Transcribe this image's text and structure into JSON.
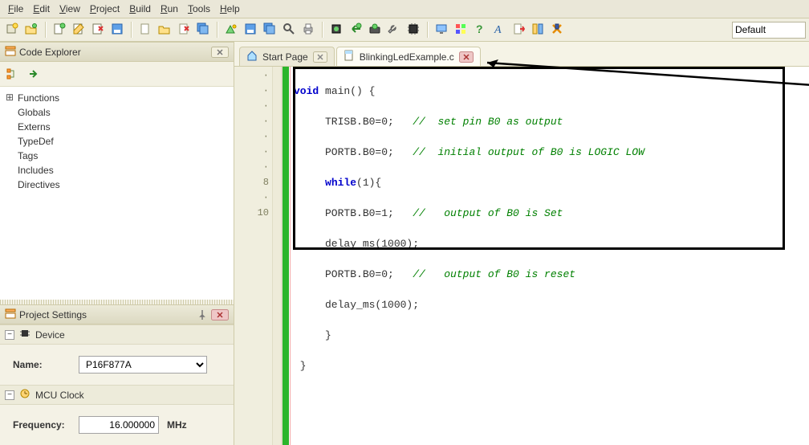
{
  "menu": {
    "items": [
      "File",
      "Edit",
      "View",
      "Project",
      "Build",
      "Run",
      "Tools",
      "Help"
    ]
  },
  "toolbar": {
    "default": "Default"
  },
  "explorer": {
    "title": "Code Explorer",
    "items": [
      "Functions",
      "Globals",
      "Externs",
      "TypeDef",
      "Tags",
      "Includes",
      "Directives"
    ]
  },
  "project": {
    "title": "Project Settings",
    "device_section": "Device",
    "name_label": "Name:",
    "name_value": "P16F877A",
    "clock_section": "MCU Clock",
    "freq_label": "Frequency:",
    "freq_value": "16.000000",
    "freq_unit": "MHz"
  },
  "tabs": {
    "start": "Start Page",
    "file": "BlinkingLedExample.c"
  },
  "gutter": {
    "lines": [
      "·",
      "·",
      "·",
      "·",
      "·",
      "·",
      "·",
      "8",
      "·",
      "10"
    ]
  },
  "code": {
    "l1": {
      "a": "void",
      "b": " main() {"
    },
    "l2": {
      "a": "     TRISB.B0=0;   ",
      "b": "//  set pin B0 as output"
    },
    "l3": {
      "a": "     PORTB.B0=0;   ",
      "b": "//  initial output of B0 is LOGIC LOW"
    },
    "l4": {
      "a": "     ",
      "b": "while",
      "c": "(1){"
    },
    "l5": {
      "a": "     PORTB.B0=1;   ",
      "b": "//   output of B0 is Set"
    },
    "l6": {
      "a": "     delay_ms(1000);"
    },
    "l7": {
      "a": "     PORTB.B0=0;   ",
      "b": "//   output of B0 is reset"
    },
    "l8": {
      "a": "     delay_ms(1000);"
    },
    "l9": {
      "a": "     }"
    },
    "l10": {
      "a": " }"
    }
  }
}
